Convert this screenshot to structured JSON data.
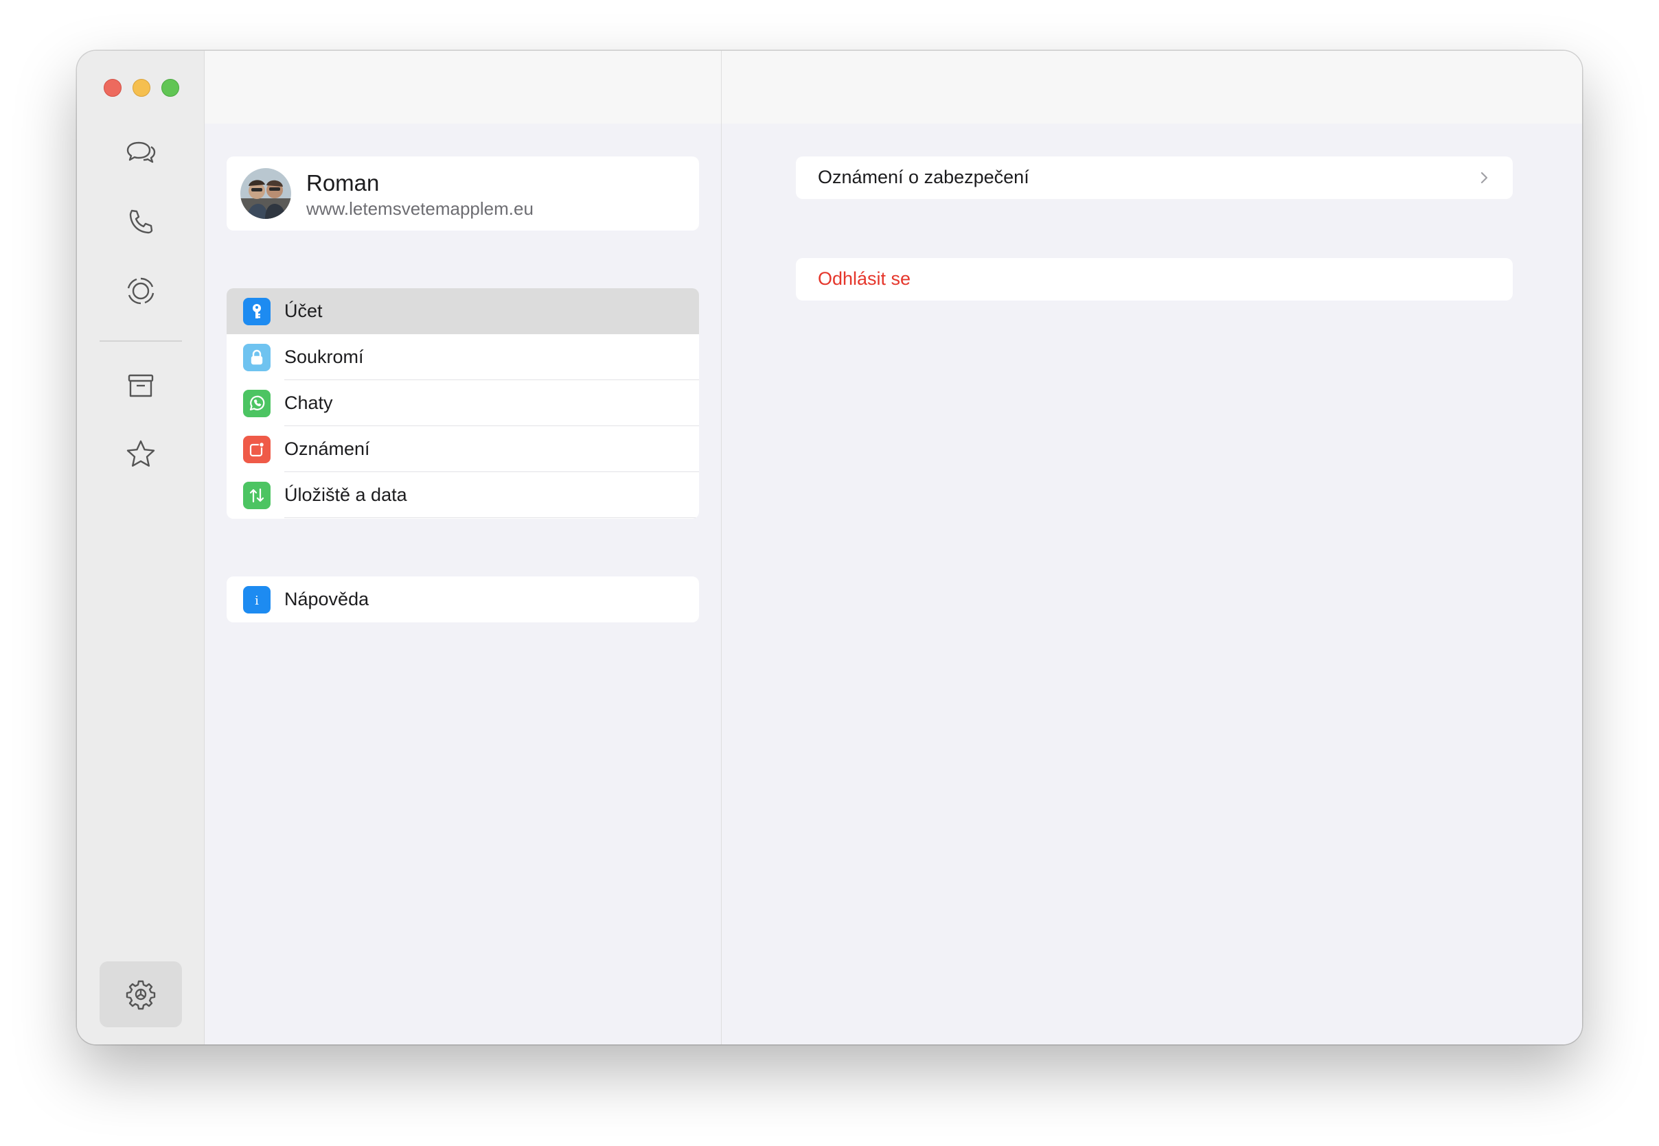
{
  "app": {
    "accent": "#1d8bf1",
    "danger_color": "#e5362b"
  },
  "rail": {
    "items": [
      {
        "icon": "chats-icon"
      },
      {
        "icon": "calls-icon"
      },
      {
        "icon": "status-icon"
      },
      {
        "icon": "archive-icon"
      },
      {
        "icon": "starred-icon"
      }
    ],
    "settings_icon": "settings-gear-icon"
  },
  "profile": {
    "name": "Roman",
    "subtitle": "www.letemsvetemapplem.eu"
  },
  "settings_menu": {
    "items": [
      {
        "label": "Účet",
        "icon": "key-icon",
        "color": "#1d8bf1",
        "selected": true
      },
      {
        "label": "Soukromí",
        "icon": "lock-icon",
        "color": "#6fc3f0",
        "selected": false
      },
      {
        "label": "Chaty",
        "icon": "whatsapp-icon",
        "color": "#4cc462",
        "selected": false
      },
      {
        "label": "Oznámení",
        "icon": "notification-icon",
        "color": "#ef5a48",
        "selected": false
      },
      {
        "label": "Úložiště a data",
        "icon": "storage-arrows-icon",
        "color": "#4cc462",
        "selected": false
      }
    ],
    "help": {
      "label": "Nápověda",
      "icon": "info-icon",
      "color": "#1d8bf1"
    }
  },
  "detail": {
    "security_notifications": "Oznámení o zabezpečení",
    "logout": "Odhlásit se"
  }
}
